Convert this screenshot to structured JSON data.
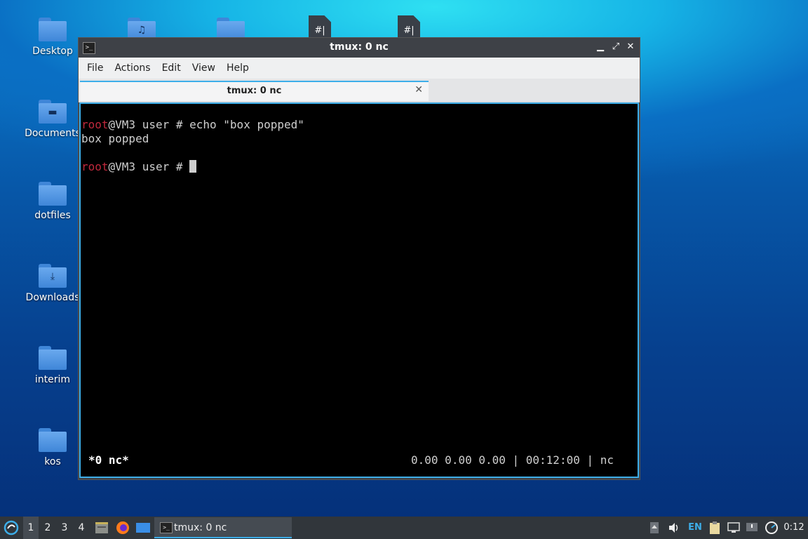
{
  "desktop": {
    "icons": [
      {
        "label": "Desktop",
        "glyph": ""
      },
      {
        "label": "Documents",
        "glyph": "▬"
      },
      {
        "label": "dotfiles",
        "glyph": ""
      },
      {
        "label": "Downloads",
        "glyph": "⤓"
      },
      {
        "label": "interim",
        "glyph": ""
      },
      {
        "label": "kos",
        "glyph": ""
      }
    ],
    "top_icons": [
      {
        "glyph": "♫"
      },
      {
        "glyph": ""
      },
      {
        "glyph": "#|"
      },
      {
        "glyph": "#|"
      }
    ]
  },
  "window": {
    "title": "tmux: 0 nc",
    "app_icon": ">_",
    "controls": {
      "minimize": "▁",
      "maximize": "⤢",
      "close": "✕"
    },
    "menu": [
      "File",
      "Actions",
      "Edit",
      "View",
      "Help"
    ],
    "tab": {
      "label": "tmux: 0 nc",
      "close": "✕"
    }
  },
  "terminal": {
    "line1": {
      "user": "root",
      "rest": "@VM3 user # echo \"box popped\""
    },
    "line2": "box popped",
    "line3": {
      "user": "root",
      "rest": "@VM3 user # "
    },
    "status_left": "*0 nc*",
    "status_right": "0.00 0.00 0.00 | 00:12:00 | nc"
  },
  "taskbar": {
    "workspaces": [
      "1",
      "2",
      "3",
      "4"
    ],
    "active_task": "tmux: 0 nc",
    "lang": "EN",
    "clock": "0:12",
    "colors": {
      "accent": "#3daee9",
      "panel": "#31363b"
    }
  }
}
